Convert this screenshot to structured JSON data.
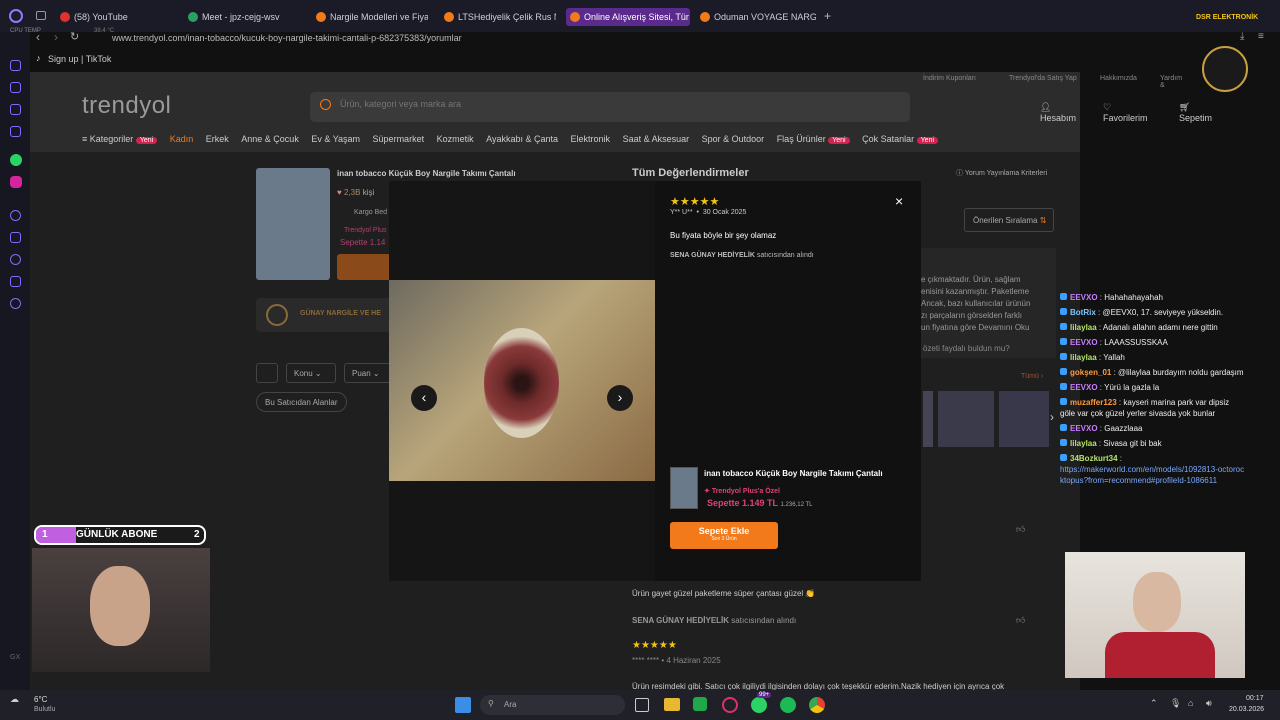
{
  "browser": {
    "cpu_label": "CPU TEMP",
    "temp": "38.4 °C",
    "tabs": [
      {
        "label": "(58) YouTube",
        "color": "#e03030"
      },
      {
        "label": "Meet - jpz-cejg-wsv",
        "color": "#2aa160"
      },
      {
        "label": "Nargile Modelleri ve Fiyatl",
        "color": "#f27a1a"
      },
      {
        "label": "LTSHediyelik Çelik Rus Na",
        "color": "#f27a1a"
      },
      {
        "label": "Online Alışveriş Sitesi, Tür",
        "color": "#f27a1a"
      },
      {
        "label": "Oduman VOYAGE NARGİLE",
        "color": "#f27a1a"
      }
    ],
    "new_tab": "+",
    "url": "www.trendyol.com/inan-tobacco/kucuk-boy-nargile-takimi-cantali-p-682375383/yorumlar",
    "bookmark": "Sign up | TikTok"
  },
  "site": {
    "logo": "trendyol",
    "top_links": [
      "İndirim Kuponları",
      "Trendyol'da Satış Yap",
      "Hakkımızda",
      "Yardım &"
    ],
    "search_placeholder": "Ürün, kategori veya marka ara",
    "account": "Hesabım",
    "favorites": "Favorilerim",
    "cart": "Sepetim",
    "nav": [
      "Kategoriler",
      "Kadın",
      "Erkek",
      "Anne & Çocuk",
      "Ev & Yaşam",
      "Süpermarket",
      "Kozmetik",
      "Ayakkabı & Çanta",
      "Elektronik",
      "Saat & Aksesuar",
      "Spor & Outdoor",
      "Flaş Ürünler",
      "Çok Satanlar"
    ],
    "new_badge": "Yeni",
    "product_title": "inan tobacco Küçük Boy Nargile Takımı Çantalı",
    "fav_count": "2,3B",
    "fav_suffix": "kişi",
    "shipping": "Kargo Bed",
    "plus_label": "Trendyol Plus",
    "plus_price": "Sepette 1.14",
    "store_name": "GÜNAY NARGİLE VE HE",
    "filter_topic": "Konu",
    "filter_score": "Puan",
    "seller_areas": "Bu Satıcıdan Alanlar",
    "all_reviews": "Tüm Değerlendirmeler",
    "criteria": "Yorum Yayınlama Kriterleri",
    "sort": "Önerilen Sıralama",
    "bg_review_lines": [
      "e çıkmaktadır. Ürün, sağlam",
      "enisini kazanmıştır. Paketleme",
      "Ancak, bazı kullanıcılar ürünün",
      "zı parçaların görselden farklı",
      "un fiyatına göre Devamını Oku"
    ],
    "helpful_q": "özeti faydalı buldun mu?",
    "all_link": "Tümü",
    "review2_text": "Ürün gayet güzel paketleme süper çantası güzel 👏",
    "review2_seller": "SENA GÜNAY HEDİYELİK",
    "bought_from": "satıcısından alındı",
    "review3_author": "**** ****",
    "review3_date": "4 Haziran 2025",
    "review3_text": "Ürün resimdeki gibi. Satıcı çok ilgiliydi ilgisinden dolayı çok teşekkür ederim.Nazik hediyen için ayrıca çok"
  },
  "modal": {
    "author": "Y** U**",
    "date": "30 Ocak 2025",
    "review": "Bu fiyata böyle bir şey olamaz",
    "seller": "SENA GÜNAY HEDİYELİK",
    "seller_suffix": "satıcısından alındı",
    "product": "inan tobacco Küçük Boy Nargile Takımı Çantalı",
    "plus_badge": "Trendyol Plus'a Özel",
    "cart_price": "Sepette 1.149 TL",
    "old_price": "1.236,12 TL",
    "add_cart": "Sepete Ekle",
    "stock": "Son 3 Ürün",
    "close": "×",
    "stars": 5
  },
  "stream": {
    "sub_goal_left": "1",
    "sub_goal_label": "GÜNLÜK ABONE",
    "sub_goal_right": "2",
    "brand": "DSR ELEKTRONİK",
    "chat": [
      {
        "user": "EEVXO",
        "text": "Hahahahayahah",
        "color": "#c77dff"
      },
      {
        "user": "BotRix",
        "text": "@EEVX0, 17. seviyeye yükseldin.",
        "color": "#7cc7ff"
      },
      {
        "user": "lilaylaa",
        "text": "Adanalı allahın adamı nere gittin",
        "color": "#b6e36b"
      },
      {
        "user": "EEVXO",
        "text": "LAAASSUSSKAA",
        "color": "#c77dff"
      },
      {
        "user": "lilaylaa",
        "text": "Yallah",
        "color": "#b6e36b"
      },
      {
        "user": "gokşen_01",
        "text": "@lilaylaa burdayım noldu gardaşım",
        "color": "#ff9a3c"
      },
      {
        "user": "EEVXO",
        "text": "Yürü la gazla la",
        "color": "#c77dff"
      },
      {
        "user": "muzaffer123",
        "text": "kayseri marina park var dipsiz göle var çok güzel yerler sivasda yok bunlar",
        "color": "#ff9a3c"
      },
      {
        "user": "EEVXO",
        "text": "Gaazzlaaa",
        "color": "#c77dff"
      },
      {
        "user": "lilaylaa",
        "text": "Sivasa git bi bak",
        "color": "#b6e36b"
      },
      {
        "user": "34Bozkurt34",
        "text": "https://makerworld.com/en/models/1092813-octorocktopus?from=recommend#profileId-1086611",
        "color": "#b6e36b"
      }
    ]
  },
  "taskbar": {
    "weather_temp": "6°C",
    "weather_desc": "Bulutlu",
    "search": "Ara",
    "badge": "99+",
    "time": "00:17",
    "date": "20.03.2026"
  }
}
